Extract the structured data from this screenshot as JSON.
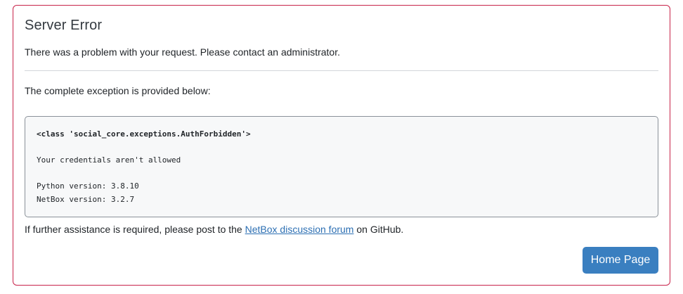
{
  "card": {
    "title": "Server Error",
    "message": "There was a problem with your request. Please contact an administrator.",
    "exception_intro": "The complete exception is provided below:",
    "exception": {
      "class_line": "<class 'social_core.exceptions.AuthForbidden'>",
      "detail_line": "Your credentials aren't allowed",
      "python_version_line": "Python version: 3.8.10",
      "netbox_version_line": "NetBox version: 3.2.7"
    },
    "assistance": {
      "prefix": "If further assistance is required, please post to the ",
      "link_text": "NetBox discussion forum",
      "suffix": " on GitHub."
    },
    "home_button_label": "Home Page"
  },
  "colors": {
    "card_border": "#c8234a",
    "link": "#2c6fb3",
    "button_bg": "#3a7fc0",
    "pre_bg": "#f7f8f9"
  }
}
